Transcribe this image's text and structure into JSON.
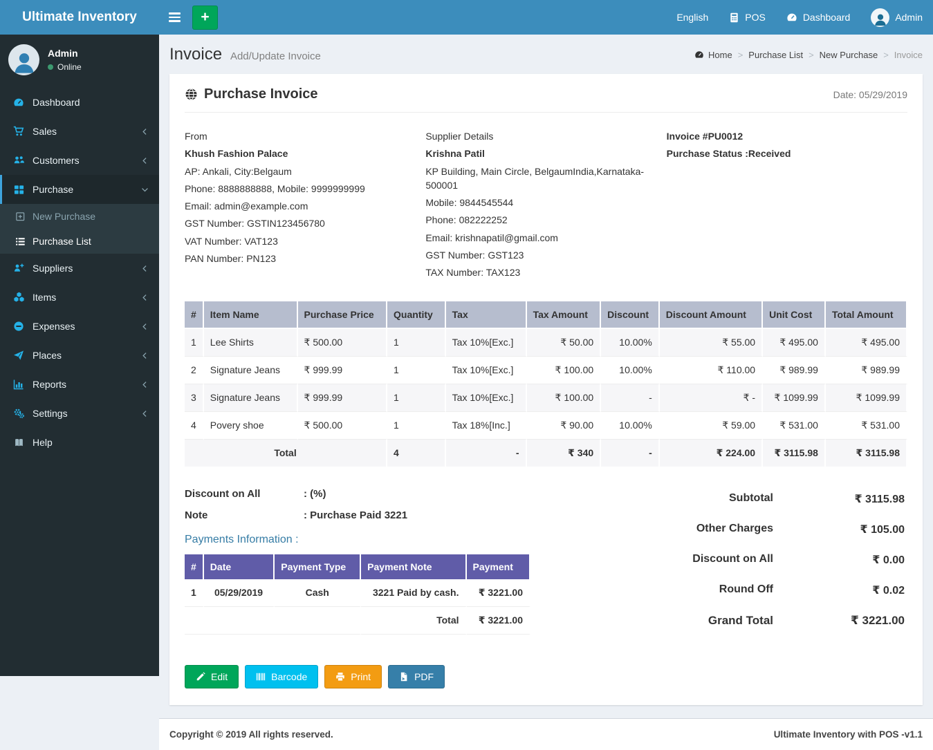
{
  "app": {
    "title": "Ultimate Inventory",
    "footer_left": "Copyright © 2019 All rights reserved.",
    "footer_right": "Ultimate Inventory with POS -v1.1"
  },
  "colors": {
    "navbar_blue": "#3c8dbc",
    "sidebar_dark": "#222d32",
    "accent_cyan": "#00c0ef",
    "success_green": "#00a65a",
    "warning_orange": "#f39c12",
    "pdf_blue": "#367fa9",
    "payments_header_purple": "#605ca8",
    "items_header_gray": "#b6bdce",
    "online_green": "#3d9970"
  },
  "navbar": {
    "add_label": "+",
    "language": "English",
    "pos_label": "POS",
    "dashboard_label": "Dashboard",
    "user_name": "Admin"
  },
  "sidebar": {
    "user": {
      "name": "Admin",
      "status": "Online"
    },
    "items": [
      {
        "label": "Dashboard",
        "icon": "tachometer-icon"
      },
      {
        "label": "Sales",
        "icon": "cart-icon"
      },
      {
        "label": "Customers",
        "icon": "users-icon"
      },
      {
        "label": "Purchase",
        "icon": "grid-icon"
      },
      {
        "label": "Suppliers",
        "icon": "user-plus-icon"
      },
      {
        "label": "Items",
        "icon": "cubes-icon"
      },
      {
        "label": "Expenses",
        "icon": "minus-circle-icon"
      },
      {
        "label": "Places",
        "icon": "paper-plane-icon"
      },
      {
        "label": "Reports",
        "icon": "bar-chart-icon"
      },
      {
        "label": "Settings",
        "icon": "gears-icon"
      },
      {
        "label": "Help",
        "icon": "book-icon"
      }
    ],
    "submenu": [
      {
        "label": "New Purchase",
        "icon": "plus-square-icon"
      },
      {
        "label": "Purchase List",
        "icon": "list-icon"
      }
    ]
  },
  "page": {
    "title": "Invoice",
    "subtitle": "Add/Update Invoice",
    "breadcrumb": {
      "home": "Home",
      "l1": "Purchase List",
      "l2": "New Purchase",
      "l3": "Invoice"
    }
  },
  "invoice": {
    "card_title": "Purchase Invoice",
    "date": "Date: 05/29/2019",
    "from": {
      "heading": "From",
      "name": "Khush Fashion Palace",
      "lines": [
        "AP: Ankali, City:Belgaum",
        "Phone: 8888888888, Mobile: 9999999999",
        "Email: admin@example.com",
        "GST Number: GSTIN123456780",
        "VAT Number: VAT123",
        "PAN Number: PN123"
      ]
    },
    "supplier": {
      "heading": "Supplier Details",
      "name": "Krishna Patil",
      "lines": [
        "KP Building, Main Circle, BelgaumIndia,Karnataka-500001",
        "Mobile: 9844545544",
        "Phone: 082222252",
        "Email: krishnapatil@gmail.com",
        "GST Number: GST123",
        "TAX Number: TAX123"
      ]
    },
    "meta": {
      "invoice_no": "Invoice #PU0012",
      "status": "Purchase Status :Received"
    },
    "items_table": {
      "headers": [
        "#",
        "Item Name",
        "Purchase Price",
        "Quantity",
        "Tax",
        "Tax Amount",
        "Discount",
        "Discount Amount",
        "Unit Cost",
        "Total Amount"
      ],
      "rows": [
        [
          "1",
          "Lee Shirts",
          "₹ 500.00",
          "1",
          "Tax 10%[Exc.]",
          "₹ 50.00",
          "10.00%",
          "₹ 55.00",
          "₹ 495.00",
          "₹ 495.00"
        ],
        [
          "2",
          "Signature Jeans",
          "₹ 999.99",
          "1",
          "Tax 10%[Exc.]",
          "₹ 100.00",
          "10.00%",
          "₹ 110.00",
          "₹ 989.99",
          "₹ 989.99"
        ],
        [
          "3",
          "Signature Jeans",
          "₹ 999.99",
          "1",
          "Tax 10%[Exc.]",
          "₹ 100.00",
          "-",
          "₹ -",
          "₹ 1099.99",
          "₹ 1099.99"
        ],
        [
          "4",
          "Povery shoe",
          "₹ 500.00",
          "1",
          "Tax 18%[Inc.]",
          "₹ 90.00",
          "10.00%",
          "₹ 59.00",
          "₹ 531.00",
          "₹ 531.00"
        ]
      ],
      "total_row": [
        "Total",
        "4",
        "-",
        "₹ 340",
        "-",
        "₹ 224.00",
        "₹ 3115.98",
        "₹ 3115.98"
      ]
    },
    "discount_on_all": {
      "label": "Discount on All",
      "value": ": (%)"
    },
    "note": {
      "label": "Note",
      "value": ": Purchase Paid 3221"
    },
    "payments": {
      "heading": "Payments Information :",
      "headers": [
        "#",
        "Date",
        "Payment Type",
        "Payment Note",
        "Payment"
      ],
      "rows": [
        [
          "1",
          "05/29/2019",
          "Cash",
          "3221 Paid by cash.",
          "₹ 3221.00"
        ]
      ],
      "total_label": "Total",
      "total_value": "₹ 3221.00"
    },
    "summary": [
      {
        "label": "Subtotal",
        "value": "₹ 3115.98"
      },
      {
        "label": "Other Charges",
        "value": "₹ 105.00"
      },
      {
        "label": "Discount on All",
        "value": "₹ 0.00"
      },
      {
        "label": "Round Off",
        "value": "₹ 0.02"
      },
      {
        "label": "Grand Total",
        "value": "₹ 3221.00"
      }
    ],
    "buttons": {
      "edit": "Edit",
      "barcode": "Barcode",
      "print": "Print",
      "pdf": "PDF"
    }
  }
}
